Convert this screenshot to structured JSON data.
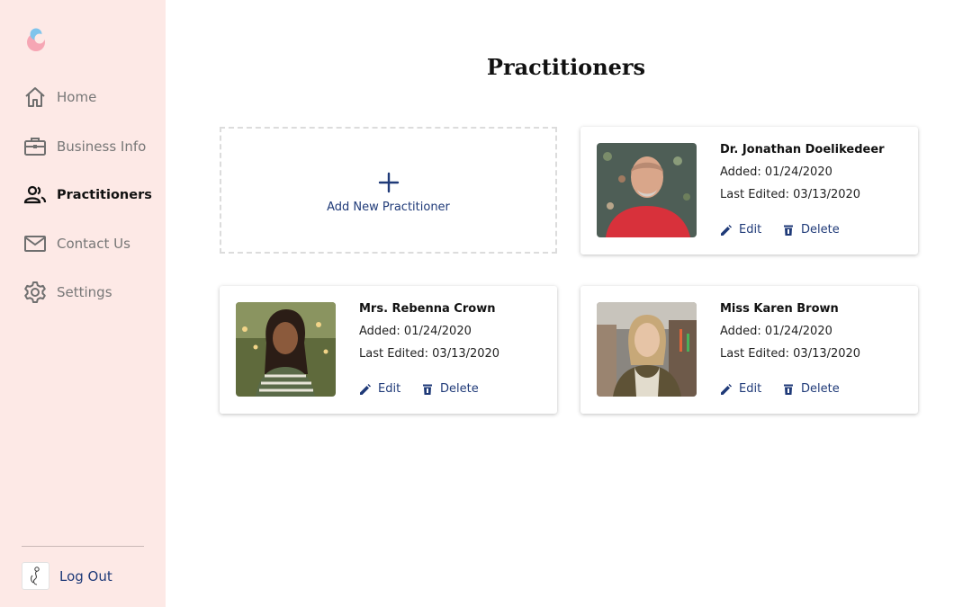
{
  "colors": {
    "sidebar_bg": "#fde9e6",
    "accent": "#1f3a78"
  },
  "sidebar": {
    "logo": "app-logo",
    "items": [
      {
        "label": "Home",
        "icon": "home-icon",
        "active": false
      },
      {
        "label": "Business Info",
        "icon": "briefcase-icon",
        "active": false
      },
      {
        "label": "Practitioners",
        "icon": "people-icon",
        "active": true
      },
      {
        "label": "Contact Us",
        "icon": "mail-icon",
        "active": false
      },
      {
        "label": "Settings",
        "icon": "gear-icon",
        "active": false
      }
    ],
    "logout_label": "Log Out"
  },
  "main": {
    "title": "Practitioners",
    "add_label": "Add New Practitioner",
    "practitioners": [
      {
        "name": "Dr. Jonathan Doelikedeer",
        "added": "Added: 01/24/2020",
        "edited": "Last Edited: 03/13/2020",
        "edit_label": "Edit",
        "delete_label": "Delete"
      },
      {
        "name": "Mrs. Rebenna Crown",
        "added": "Added: 01/24/2020",
        "edited": "Last Edited: 03/13/2020",
        "edit_label": "Edit",
        "delete_label": "Delete"
      },
      {
        "name": "Miss Karen Brown",
        "added": "Added: 01/24/2020",
        "edited": "Last Edited: 03/13/2020",
        "edit_label": "Edit",
        "delete_label": "Delete"
      }
    ]
  }
}
